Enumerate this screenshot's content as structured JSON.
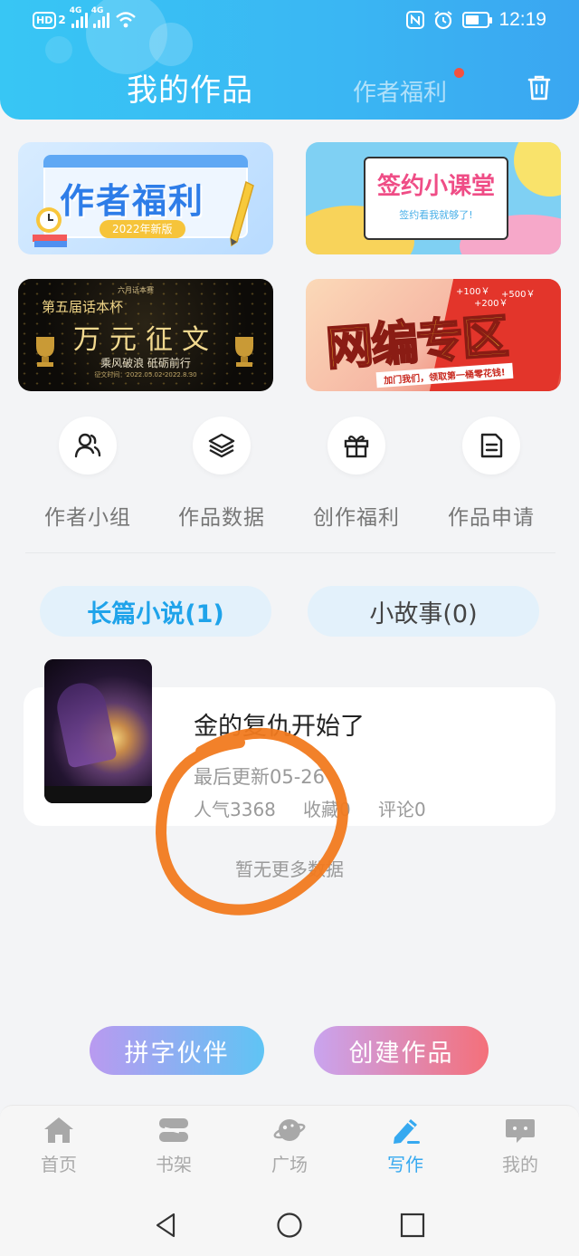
{
  "status_bar": {
    "hd": "HD",
    "sim": "2",
    "net1": "4G",
    "net2": "4G",
    "time": "12:19"
  },
  "header": {
    "title": "我的作品",
    "welfare_tab": "作者福利",
    "trash_icon": "trash-icon"
  },
  "banners": [
    {
      "title": "作者福利",
      "subtitle": "2022年新版"
    },
    {
      "title": "签约小课堂",
      "subtitle": "签约看我就够了!"
    },
    {
      "header": "六月话本赛",
      "title": "第五届话本杯",
      "main": "万元征文",
      "slogan": "乘风破浪 砥砺前行",
      "footer": "征文时间：2022.05.02-2022.8.30"
    },
    {
      "title": "网编专区",
      "subtitle": "加门我们，领取第一桶零花钱!",
      "values": [
        "+100￥",
        "+500￥",
        "+200￥"
      ]
    }
  ],
  "quick_actions": [
    {
      "label": "作者小组",
      "icon": "group-icon"
    },
    {
      "label": "作品数据",
      "icon": "layers-icon"
    },
    {
      "label": "创作福利",
      "icon": "gift-icon"
    },
    {
      "label": "作品申请",
      "icon": "document-icon"
    }
  ],
  "category_tabs": [
    {
      "label": "长篇小说(1)",
      "active": true
    },
    {
      "label": "小故事(0)",
      "active": false
    }
  ],
  "work": {
    "title": "金的复仇开始了",
    "last_update": "最后更新05-26",
    "popularity": "人气3368",
    "favorites": "收藏0",
    "comments": "评论0"
  },
  "no_more": "暂无更多数据",
  "actions": {
    "partner": "拼字伙伴",
    "create": "创建作品"
  },
  "bottom_nav": [
    {
      "label": "首页",
      "icon": "home-icon",
      "active": false
    },
    {
      "label": "书架",
      "icon": "bookshelf-icon",
      "active": false
    },
    {
      "label": "广场",
      "icon": "planet-icon",
      "active": false
    },
    {
      "label": "写作",
      "icon": "pen-icon",
      "active": true
    },
    {
      "label": "我的",
      "icon": "chat-icon",
      "active": false
    }
  ],
  "colors": {
    "accent": "#3aa6f1",
    "active_tab_text": "#1fa3ea",
    "annotation": "#f17a1f"
  }
}
